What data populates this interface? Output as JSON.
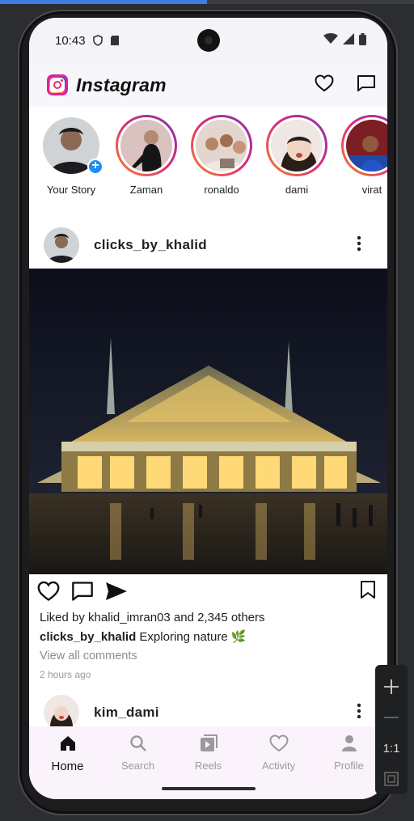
{
  "window": {
    "progress_fraction": 0.5
  },
  "statusbar": {
    "time": "10:43"
  },
  "appbar": {
    "title": "Instagram",
    "icons": [
      "heart-icon",
      "message-icon"
    ]
  },
  "stories": [
    {
      "name": "Your Story",
      "own": true
    },
    {
      "name": "Zaman"
    },
    {
      "name": "ronaldo"
    },
    {
      "name": "dami"
    },
    {
      "name": "virat"
    }
  ],
  "post1": {
    "username": "clicks_by_khalid",
    "likes_text": "Liked by khalid_imran03 and 2,345 others",
    "caption_user": "clicks_by_khalid",
    "caption_text": "Exploring nature 🌿",
    "view_comments": "View all comments",
    "time_ago": "2 hours ago"
  },
  "post2": {
    "username": "kim_dami"
  },
  "navbar": {
    "items": [
      {
        "label": "Home",
        "icon": "home-icon",
        "active": true
      },
      {
        "label": "Search",
        "icon": "search-icon"
      },
      {
        "label": "Reels",
        "icon": "reels-icon"
      },
      {
        "label": "Activity",
        "icon": "heart-icon"
      },
      {
        "label": "Profile",
        "icon": "profile-icon"
      }
    ]
  },
  "emulator_toolbar": {
    "ratio_label": "1:1"
  },
  "colors": {
    "accent_blue": "#1e8ef5",
    "story_ring_start": "#f58529",
    "story_ring_end": "#8134af",
    "nav_bg": "#fbf3fb"
  }
}
